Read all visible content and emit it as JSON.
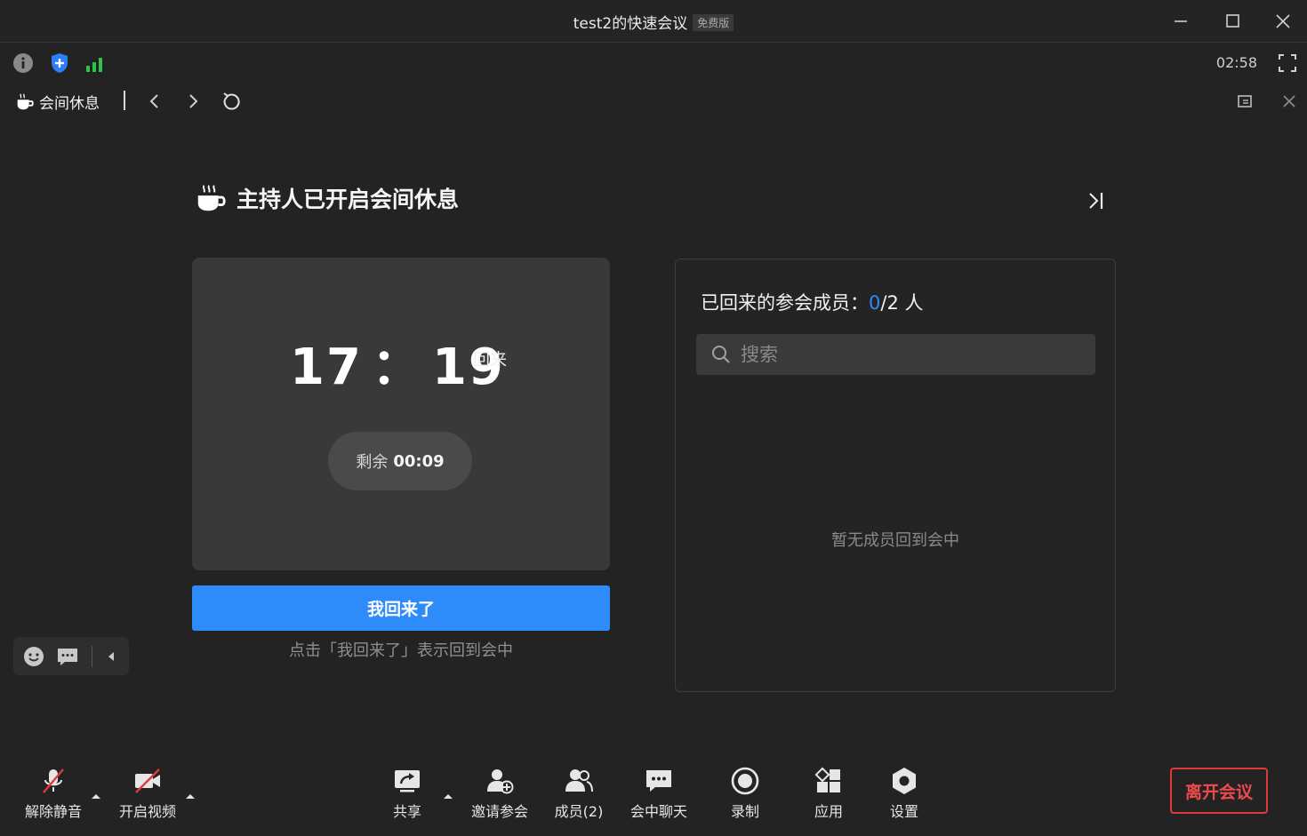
{
  "window": {
    "title": "test2的快速会议",
    "badge": "免费版"
  },
  "info": {
    "elapsed": "02:58"
  },
  "toolbar": {
    "break_label": "会间休息"
  },
  "main": {
    "heading": "主持人已开启会间休息",
    "clock_hour": "17",
    "clock_colon": "：",
    "clock_minute": "19",
    "clock_suffix": "回来",
    "remain_label": "剩余",
    "remain_value": "00:09",
    "back_button": "我回来了",
    "hint": "点击「我回来了」表示回到会中"
  },
  "members": {
    "title_prefix": "已回来的参会成员：",
    "returned": "0",
    "total": "/2 人",
    "search_placeholder": "搜索",
    "empty_text": "暂无成员回到会中"
  },
  "bottom": {
    "unmute": "解除静音",
    "video": "开启视频",
    "share": "共享",
    "invite": "邀请参会",
    "members": "成员(2)",
    "chat": "会中聊天",
    "record": "录制",
    "apps": "应用",
    "settings": "设置",
    "leave": "离开会议"
  },
  "colors": {
    "accent": "#2d8cf9",
    "danger": "#e0393c",
    "signal": "#2ec24a",
    "shield": "#2d7ff9"
  }
}
